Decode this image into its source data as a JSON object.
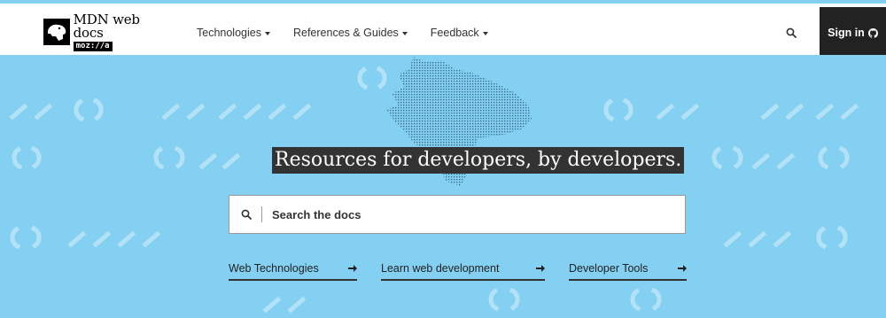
{
  "colors": {
    "hero_background": "#83d0f2",
    "header_background": "#ffffff",
    "signin_background": "#222222",
    "headline_background": "#333333",
    "text": "#333333"
  },
  "logo": {
    "title": "MDN web docs",
    "subtitle": "moz://a",
    "icon": "mdn-dino-icon"
  },
  "nav": {
    "items": [
      {
        "label": "Technologies",
        "icon": "caret-down-icon"
      },
      {
        "label": "References & Guides",
        "icon": "caret-down-icon"
      },
      {
        "label": "Feedback",
        "icon": "caret-down-icon"
      }
    ]
  },
  "header": {
    "search_icon": "search-icon",
    "signin_label": "Sign in",
    "signin_icon": "github-icon"
  },
  "hero": {
    "headline": "Resources for developers, by developers.",
    "illustration": "dinosaur-head-icon",
    "search": {
      "placeholder": "Search the docs",
      "value": "",
      "icon": "search-icon"
    },
    "quick_links": [
      {
        "label": "Web Technologies",
        "icon": "arrow-right-icon"
      },
      {
        "label": "Learn web development",
        "icon": "arrow-right-icon"
      },
      {
        "label": "Developer Tools",
        "icon": "arrow-right-icon"
      }
    ]
  }
}
